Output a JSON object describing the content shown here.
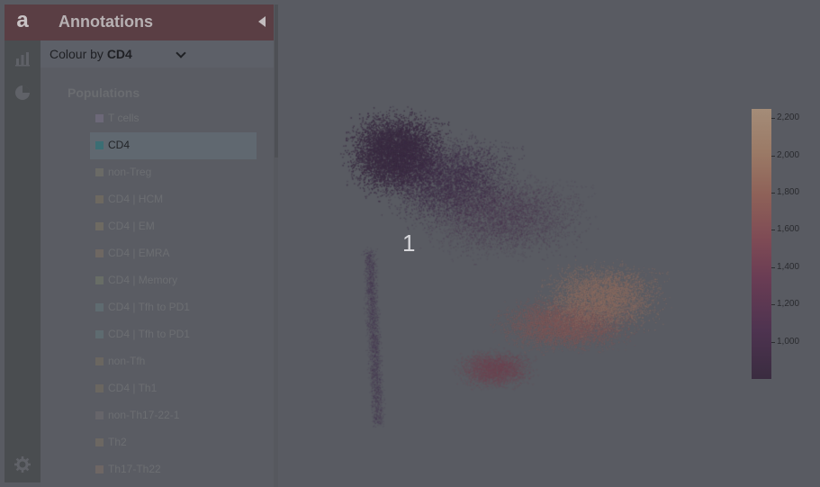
{
  "rail": {
    "logo": "a",
    "icons": [
      "chart-icon",
      "pie-chart-icon",
      "gear-icon"
    ]
  },
  "panel": {
    "title": "Annotations",
    "colour_by_prefix": "Colour by ",
    "colour_by_value": "CD4",
    "populations_title": "Populations",
    "populations": [
      {
        "label": "T cells",
        "color": "#6c6878",
        "selected": false
      },
      {
        "label": "CD4",
        "color": "#3b6e74",
        "selected": true
      },
      {
        "label": "non-Treg",
        "color": "#6a6a66",
        "selected": false
      },
      {
        "label": "CD4 | HCM",
        "color": "#6d6860",
        "selected": false
      },
      {
        "label": "CD4 | EM",
        "color": "#6e6a62",
        "selected": false
      },
      {
        "label": "CD4 | EMRA",
        "color": "#6e6762",
        "selected": false
      },
      {
        "label": "CD4 | Memory",
        "color": "#686d66",
        "selected": false
      },
      {
        "label": "CD4 | Tfh to PD1",
        "color": "#5f6b70",
        "selected": false
      },
      {
        "label": "CD4 | Tfh to PD1",
        "color": "#5e6b70",
        "selected": false
      },
      {
        "label": "non-Tfh",
        "color": "#6a6660",
        "selected": false
      },
      {
        "label": "CD4 | Th1",
        "color": "#6a6660",
        "selected": false
      },
      {
        "label": "non-Th17-22-1",
        "color": "#66656a",
        "selected": false
      },
      {
        "label": "Th2",
        "color": "#6c6762",
        "selected": false
      },
      {
        "label": "Th17-Th22",
        "color": "#6e6664",
        "selected": false
      }
    ]
  },
  "plot": {
    "cluster_label": "1"
  },
  "colorbar": {
    "min": 800,
    "max": 2250,
    "ticks": [
      "1,000",
      "1,200",
      "1,400",
      "1,600",
      "1,800",
      "2,000",
      "2,200"
    ],
    "tick_values": [
      1000,
      1200,
      1400,
      1600,
      1800,
      2000,
      2200
    ]
  }
}
